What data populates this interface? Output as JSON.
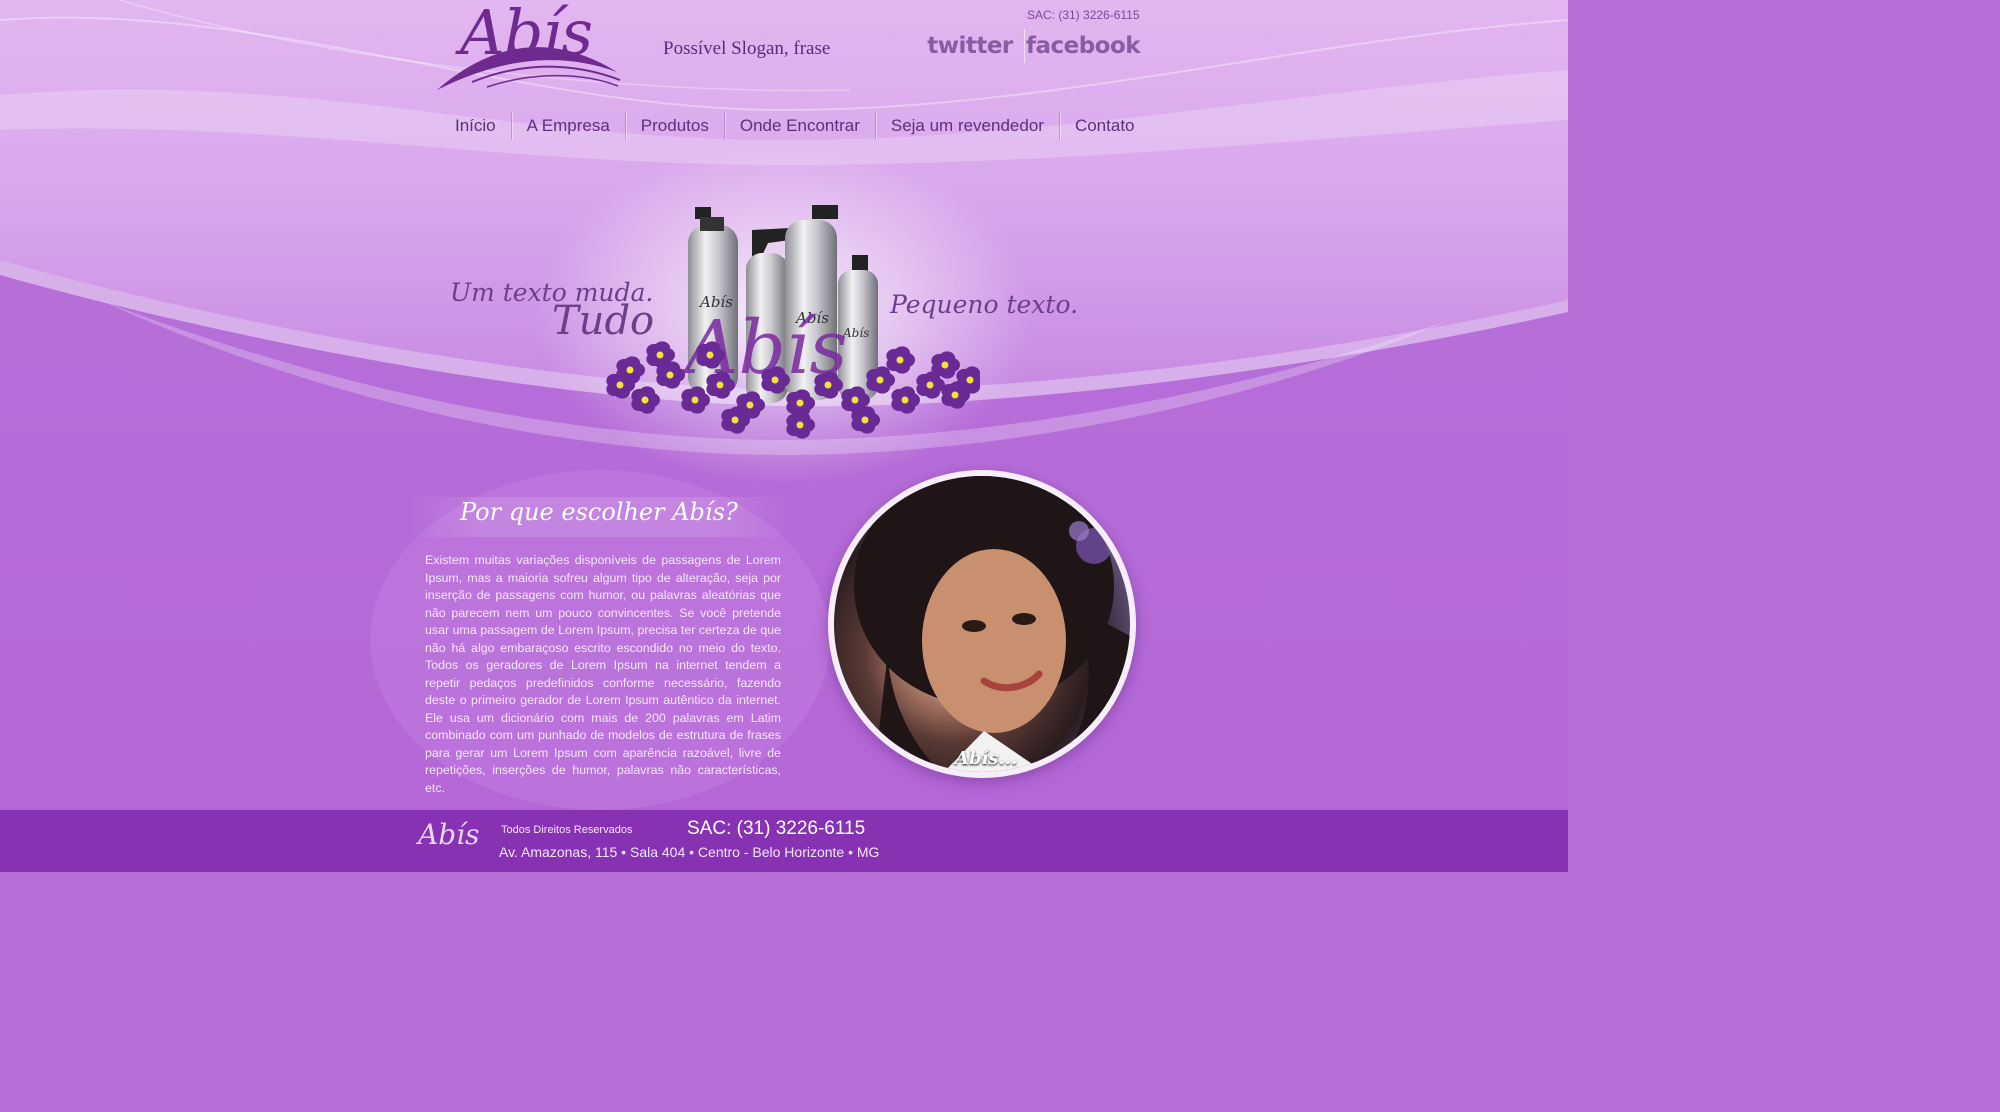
{
  "header": {
    "logo_text": "Abís",
    "slogan": "Possível Slogan, frase",
    "sac": "SAC: (31) 3226-6115",
    "social": {
      "twitter": "twitter",
      "facebook": "facebook"
    }
  },
  "nav": {
    "items": [
      {
        "label": "Início"
      },
      {
        "label": "A Empresa"
      },
      {
        "label": "Produtos"
      },
      {
        "label": "Onde Encontrar"
      },
      {
        "label": "Seja um revendedor"
      },
      {
        "label": "Contato"
      }
    ]
  },
  "hero": {
    "line1": "Um texto muda.",
    "line2": "Tudo",
    "right_text": "Pequeno texto.",
    "product_brand": "Abís"
  },
  "about": {
    "title": "Por que escolher Abís?",
    "text": "Existem muitas variações disponíveis de passagens de Lorem Ipsum, mas a maioria sofreu algum tipo de alteração, seja por inserção de passagens com humor, ou palavras aleatórias que não parecem nem um pouco convincentes. Se você pretende usar uma passagem de Lorem Ipsum, precisa ter certeza de que não há algo embaraçoso escrito escondido no meio do texto. Todos os geradores de Lorem Ipsum na internet tendem a repetir pedaços predefinidos conforme necessário, fazendo deste o primeiro gerador de Lorem Ipsum autêntico da internet. Ele usa um dicionário com mais de 200 palavras em Latim combinado com um punhado de modelos de estrutura de frases para gerar um Lorem Ipsum com aparência razoável, livre de repetições, inserções de humor, palavras não características, etc."
  },
  "photo": {
    "signature": "Abís..."
  },
  "footer": {
    "logo_text": "Abís",
    "rights": "Todos Direitos Reservados",
    "sac": "SAC: (31) 3226-6115",
    "address": "Av. Amazonas, 115 • Sala 404 • Centro - Belo Horizonte • MG"
  },
  "colors": {
    "brand_purple": "#6e2a8f",
    "background": "#b56dd8",
    "footer": "#8732b3",
    "flower": "#6a2a96",
    "flower_center": "#f2e23a"
  }
}
